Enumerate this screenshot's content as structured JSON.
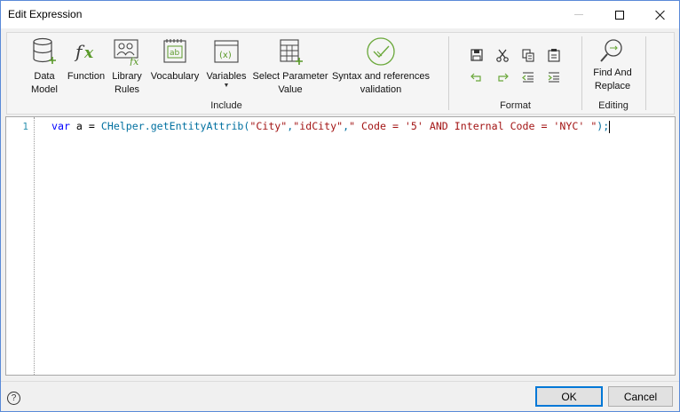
{
  "window": {
    "title": "Edit Expression",
    "icons": [
      "minimize-icon",
      "maximize-icon",
      "close-icon"
    ]
  },
  "ribbon": {
    "include": {
      "label": "Include",
      "buttons": [
        {
          "label": "Data\nModel",
          "icon": "database-add-icon"
        },
        {
          "label": "Function",
          "icon": "function-fx-icon"
        },
        {
          "label": "Library\nRules",
          "icon": "library-rules-icon"
        },
        {
          "label": "Vocabulary",
          "icon": "vocabulary-icon"
        },
        {
          "label": "Variables",
          "icon": "variables-icon"
        },
        {
          "label": "Select Parameter\nValue",
          "icon": "table-add-icon"
        },
        {
          "label": "Syntax and references\nvalidation",
          "icon": "validation-check-icon"
        }
      ]
    },
    "format": {
      "label": "Format",
      "buttons": [
        "save-icon",
        "cut-icon",
        "copy-icon",
        "paste-icon",
        "undo-icon",
        "redo-icon",
        "outdent-icon",
        "indent-icon"
      ]
    },
    "editing": {
      "label": "Editing",
      "buttons": [
        {
          "label": "Find And\nReplace",
          "icon": "find-replace-icon"
        }
      ]
    }
  },
  "editor": {
    "line_number": "1",
    "tokens": {
      "kw": "var",
      "ident": " a = ",
      "fn": "CHelper.getEntityAttrib(",
      "s1": "\"City\"",
      "c1": ",",
      "s2": "\"idCity\"",
      "c2": ",",
      "s3": "\" Code = '5' AND Internal Code = 'NYC' \"",
      "end": ");"
    },
    "colors": {
      "keyword": "#0000ff",
      "string": "#a31515",
      "function": "#0070a0",
      "line_number": "#2b91af"
    }
  },
  "footer": {
    "help": "?",
    "ok": "OK",
    "cancel": "Cancel"
  }
}
